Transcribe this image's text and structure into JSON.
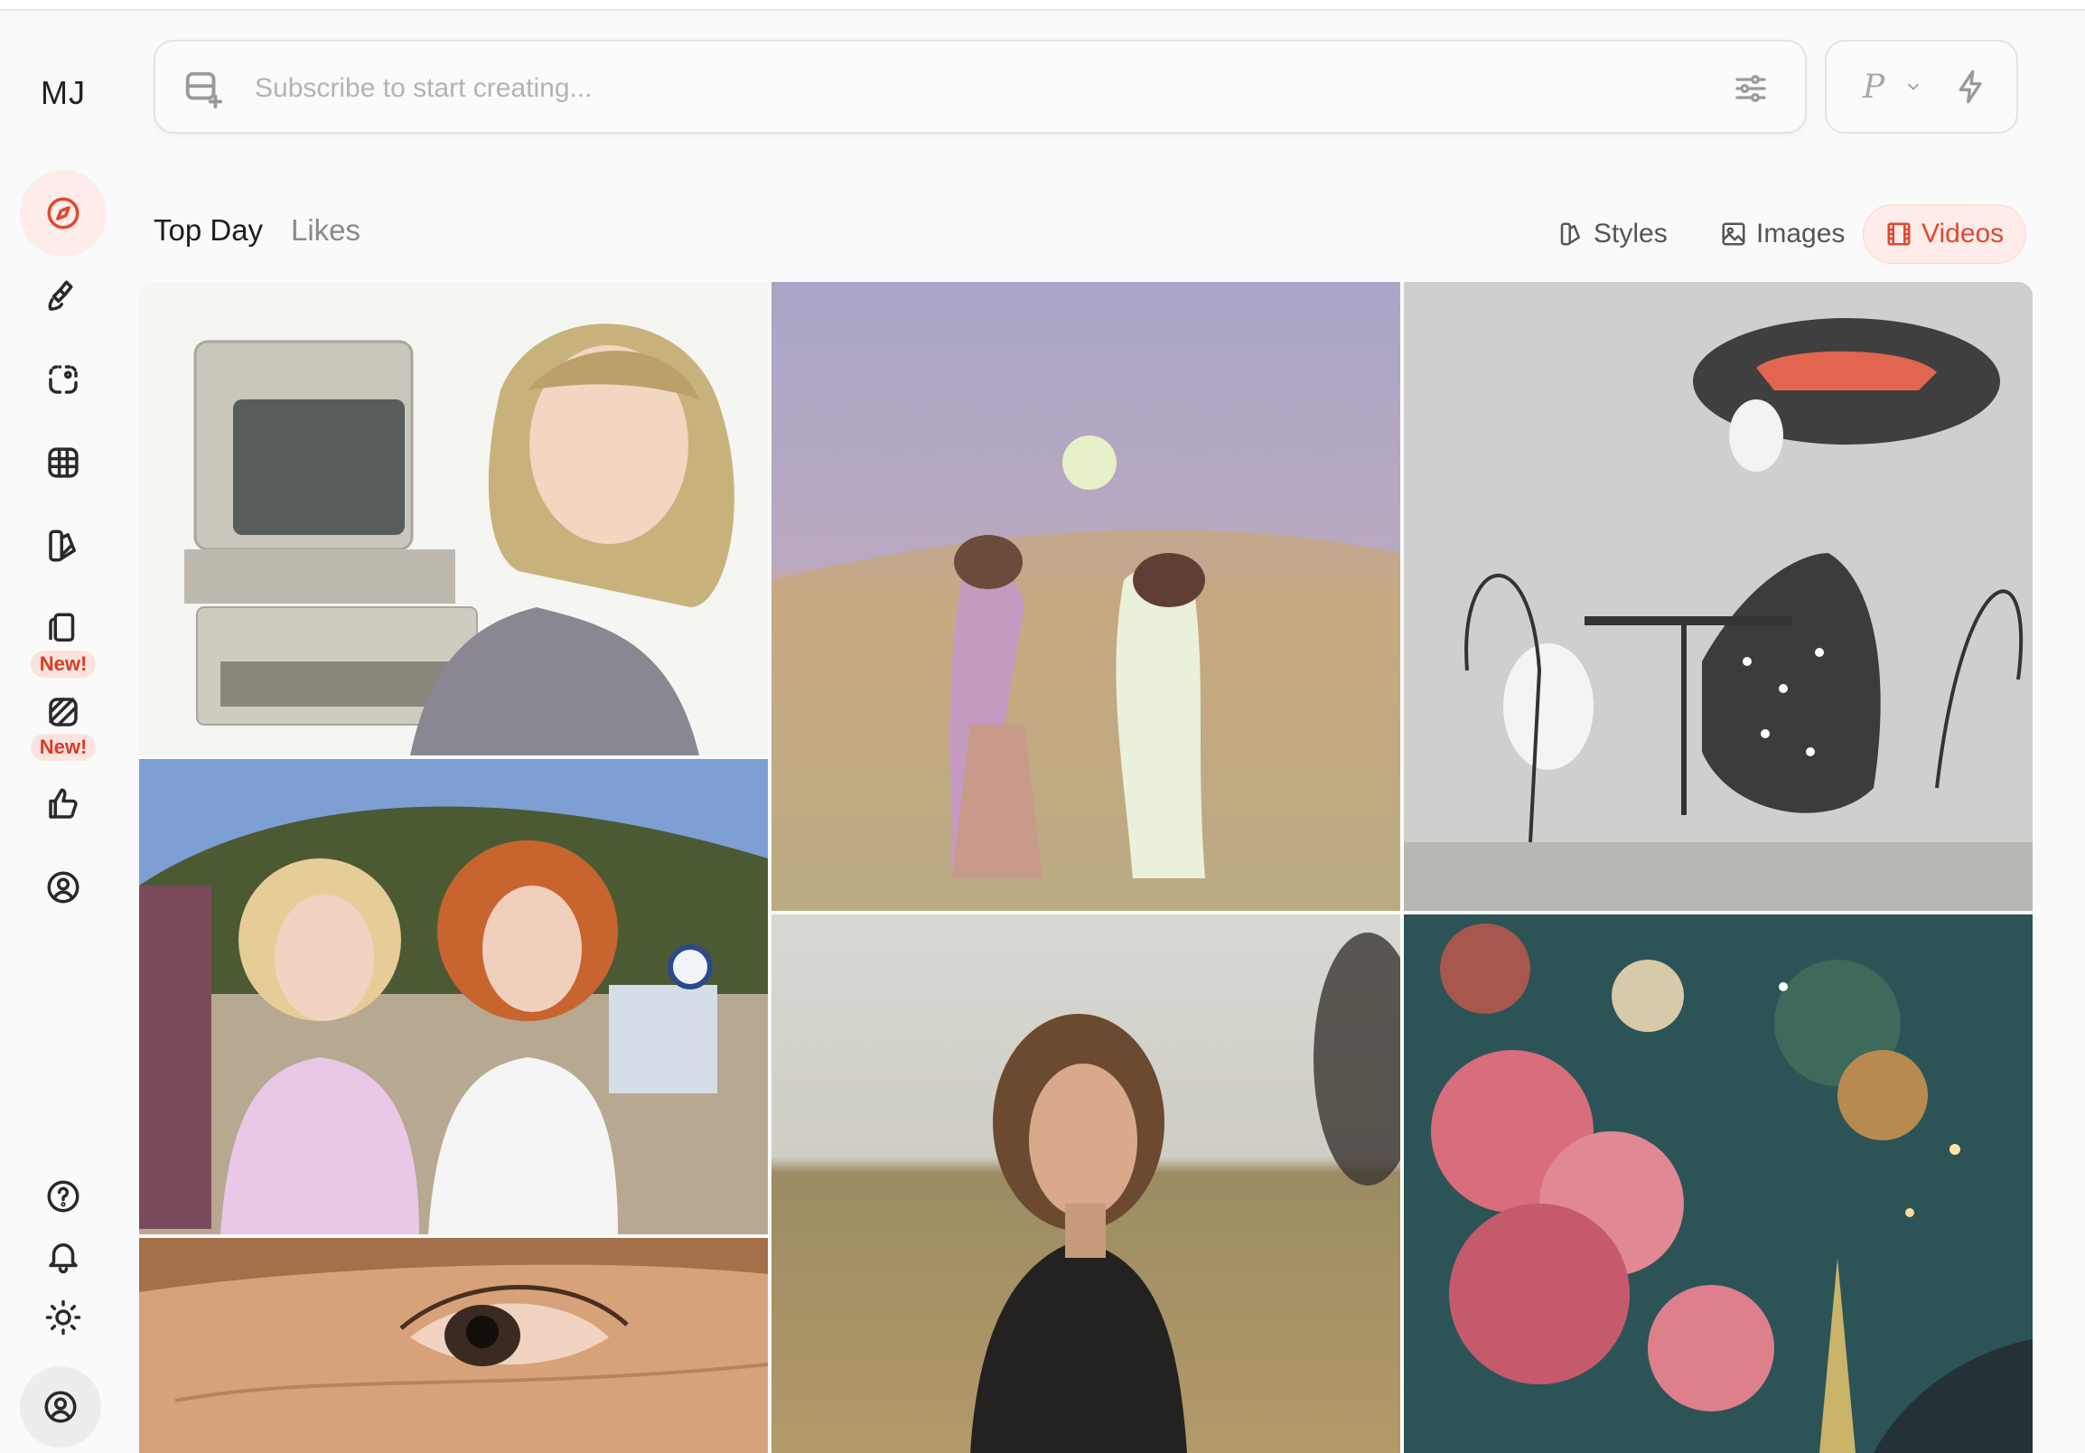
{
  "app": {
    "logo": "MJ"
  },
  "sidebar": {
    "items": [
      {
        "icon": "compass-icon",
        "active": true
      },
      {
        "icon": "brush-icon"
      },
      {
        "icon": "edit-selection-icon"
      },
      {
        "icon": "grid-globe-icon"
      },
      {
        "icon": "style-palette-icon"
      },
      {
        "icon": "cards-icon",
        "badge": "New!"
      },
      {
        "icon": "pattern-icon",
        "badge": "New!"
      },
      {
        "icon": "thumbs-up-icon"
      },
      {
        "icon": "profile-icon"
      }
    ],
    "bottom": [
      {
        "icon": "help-icon"
      },
      {
        "icon": "bell-icon"
      },
      {
        "icon": "sun-icon"
      },
      {
        "icon": "account-icon"
      }
    ],
    "badge_label": "New!"
  },
  "prompt": {
    "placeholder": "Subscribe to start creating...",
    "mode_letter": "P"
  },
  "tabs": {
    "top_day": "Top Day",
    "likes": "Likes"
  },
  "filters": {
    "styles": "Styles",
    "images": "Images",
    "videos": "Videos",
    "active": "Videos"
  },
  "colors": {
    "accent": "#e2472f",
    "accent_bg": "#fdecea",
    "page_bg": "#fafafa"
  },
  "gallery": {
    "items": [
      {
        "alt": "girl with vintage computer"
      },
      {
        "alt": "two figures dancing in meadow painting"
      },
      {
        "alt": "woman in hat at cafe table with dog"
      },
      {
        "alt": "two girls in village street"
      },
      {
        "alt": "woman in field portrait"
      },
      {
        "alt": "pink blossoms and glittering lights"
      },
      {
        "alt": "close-up of eye"
      }
    ]
  }
}
